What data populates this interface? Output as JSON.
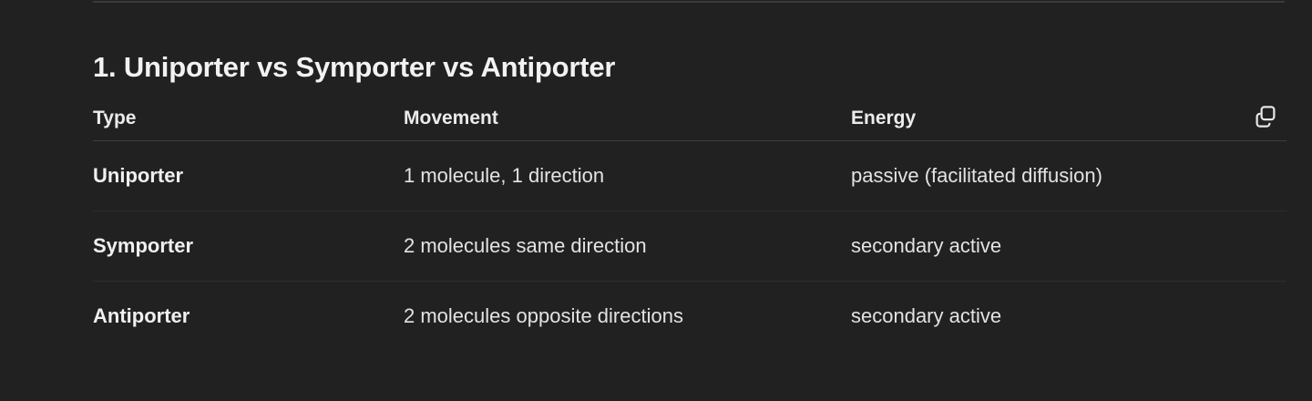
{
  "section": {
    "heading": "1. Uniporter vs Symporter vs Antiporter"
  },
  "table": {
    "headers": [
      "Type",
      "Movement",
      "Energy"
    ],
    "rows": [
      [
        "Uniporter",
        "1 molecule, 1 direction",
        "passive (facilitated diffusion)"
      ],
      [
        "Symporter",
        "2 molecules same direction",
        "secondary active"
      ],
      [
        "Antiporter",
        "2 molecules opposite directions",
        "secondary active"
      ]
    ],
    "copy_icon": "copy-icon"
  },
  "colors": {
    "background": "#212121",
    "text": "#ececec",
    "divider": "#3d3d3d"
  }
}
